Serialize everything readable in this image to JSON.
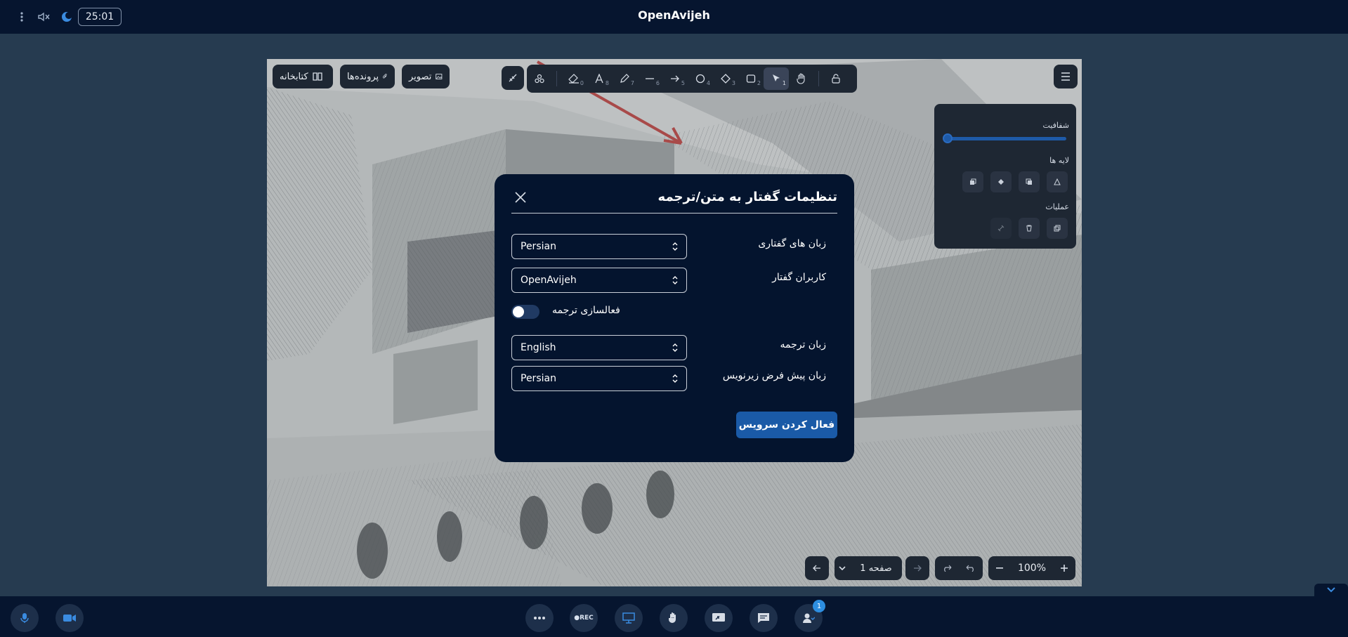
{
  "app": {
    "title": "OpenAvijeh",
    "timer": "25:01"
  },
  "board": {
    "buttons": {
      "library": "کتابخانه",
      "files": "پرونده‌ها",
      "image": "تصویر"
    },
    "tools": [
      {
        "name": "lock-tool",
        "shortcut": ""
      },
      {
        "name": "hand-tool",
        "shortcut": ""
      },
      {
        "name": "select-tool",
        "shortcut": "1"
      },
      {
        "name": "rectangle-tool",
        "shortcut": "2"
      },
      {
        "name": "diamond-tool",
        "shortcut": "3"
      },
      {
        "name": "ellipse-tool",
        "shortcut": "4"
      },
      {
        "name": "arrow-tool",
        "shortcut": "5"
      },
      {
        "name": "line-tool",
        "shortcut": "6"
      },
      {
        "name": "pencil-tool",
        "shortcut": "7"
      },
      {
        "name": "text-tool",
        "shortcut": "8"
      },
      {
        "name": "eraser-tool",
        "shortcut": "0"
      }
    ],
    "properties": {
      "opacity_label": "شفافیت",
      "opacity_value": 0,
      "layers_label": "لایه ها",
      "actions_label": "عملیات"
    },
    "zoom": "100%",
    "page_label": "صفحه 1"
  },
  "modal": {
    "title": "تنظیمات گفتار به متن/ترجمه",
    "spoken_languages_label": "زبان های گفتاری",
    "spoken_languages_value": "Persian",
    "speaker_users_label": "کاربران گفتار",
    "speaker_users_value": "OpenAvijeh",
    "translation_toggle_label": "فعالسازی ترجمه",
    "translation_enabled": false,
    "translation_language_label": "زبان ترجمه",
    "translation_language_value": "English",
    "default_subtitle_label": "زبان پیش فرض زیرنویس",
    "default_subtitle_value": "Persian",
    "activate_button": "فعال کردن سرویس"
  },
  "bottombar": {
    "rec_label": "●REC",
    "participants_count": "1"
  },
  "colors": {
    "navy": "#06152f",
    "modal_bg": "#04142e",
    "accent": "#1a5aa7",
    "badge": "#2d8ee0"
  }
}
